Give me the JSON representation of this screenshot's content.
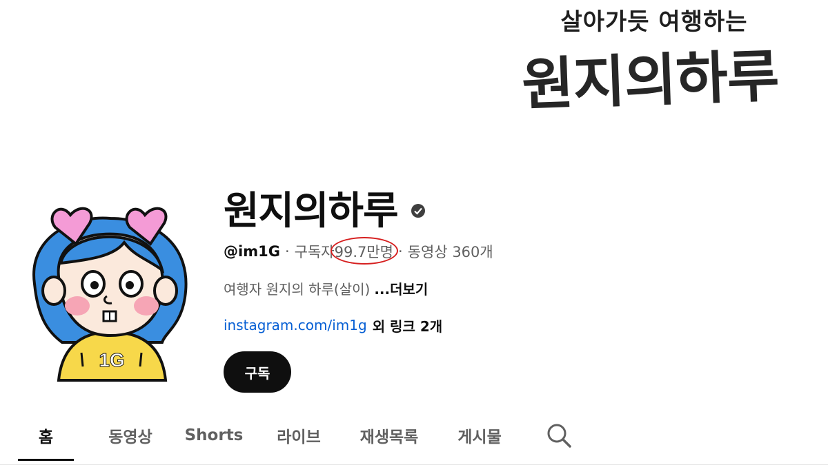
{
  "banner": {
    "tagline": "살아가듯 여행하는",
    "title": "원지의하루"
  },
  "avatar": {
    "shirt_text": "1G"
  },
  "channel": {
    "name": "원지의하루",
    "verified": true,
    "handle": "@im1G",
    "subscribers_label": "구독자",
    "subscribers_count": "99.7만명",
    "videos_label": "동영상 360개",
    "separator": "·",
    "description": "여행자 원지의 하루(살이)",
    "more_label": "...더보기",
    "link_text": "instagram.com/im1g",
    "extra_links": "외 링크 2개",
    "subscribe_label": "구독"
  },
  "annotation": {
    "highlight_color": "#d61f1f"
  },
  "tabs": [
    {
      "label": "홈",
      "active": true
    },
    {
      "label": "동영상",
      "active": false
    },
    {
      "label": "Shorts",
      "active": false
    },
    {
      "label": "라이브",
      "active": false
    },
    {
      "label": "재생목록",
      "active": false
    },
    {
      "label": "게시물",
      "active": false
    }
  ],
  "icons": {
    "verified": "verified-check-icon",
    "search": "search-icon"
  }
}
